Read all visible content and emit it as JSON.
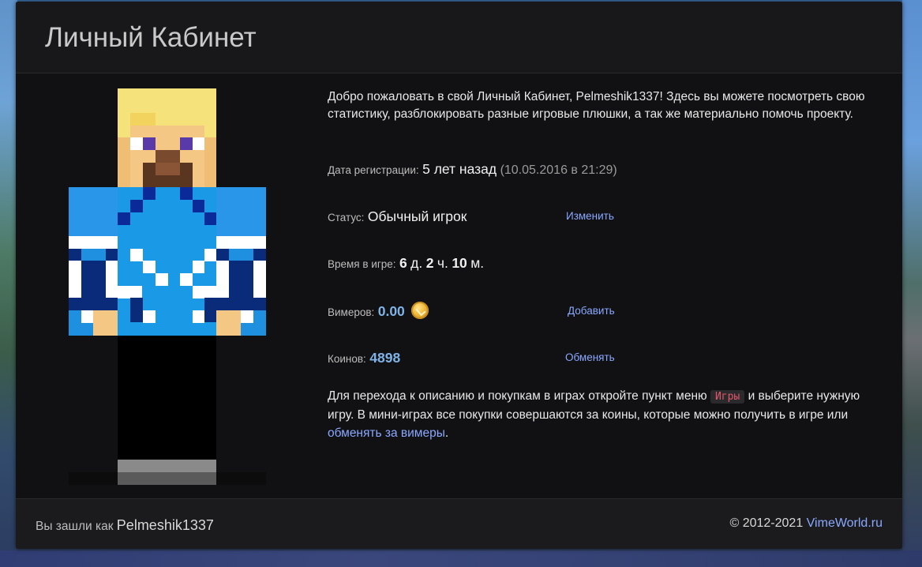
{
  "page": {
    "title": "Личный Кабинет"
  },
  "welcome": {
    "text": "Добро пожаловать в свой Личный Кабинет, Pelmeshik1337! Здесь вы можете посмотреть свою статистику, разблокировать разные игровые плюшки, а так же материально помочь проекту."
  },
  "registration": {
    "label": "Дата регистрации:",
    "value": "5 лет назад",
    "date": "(10.05.2016 в 21:29)"
  },
  "status": {
    "label": "Статус:",
    "value": "Обычный игрок",
    "action": "Изменить"
  },
  "playtime": {
    "label": "Время в игре:",
    "days": "6",
    "days_unit": "д.",
    "hours": "2",
    "hours_unit": "ч.",
    "minutes": "10",
    "minutes_unit": "м."
  },
  "vimers": {
    "label": "Вимеров:",
    "value": "0.00",
    "icon": "vimer-coin-icon",
    "action": "Добавить"
  },
  "coins": {
    "label": "Коинов:",
    "value": "4898",
    "action": "Обменять"
  },
  "info": {
    "part1": "Для перехода к описанию и покупкам в играх откройте пункт меню",
    "menu_item": "Игры",
    "part2": "и выберите нужную игру. В мини-играх все покупки совершаются за коины, которые можно получить в игре или",
    "link": "обменять за вимеры",
    "part3": "."
  },
  "footer": {
    "logged_in_label": "Вы зашли как",
    "username": "Pelmeshik1337",
    "copyright": "© 2012-2021",
    "site_link": "VimeWorld.ru"
  },
  "colors": {
    "panel_bg": "#111113",
    "accent_link": "#8aa8ff",
    "value_blue": "#7fb3e6",
    "code_red": "#e4566c"
  }
}
